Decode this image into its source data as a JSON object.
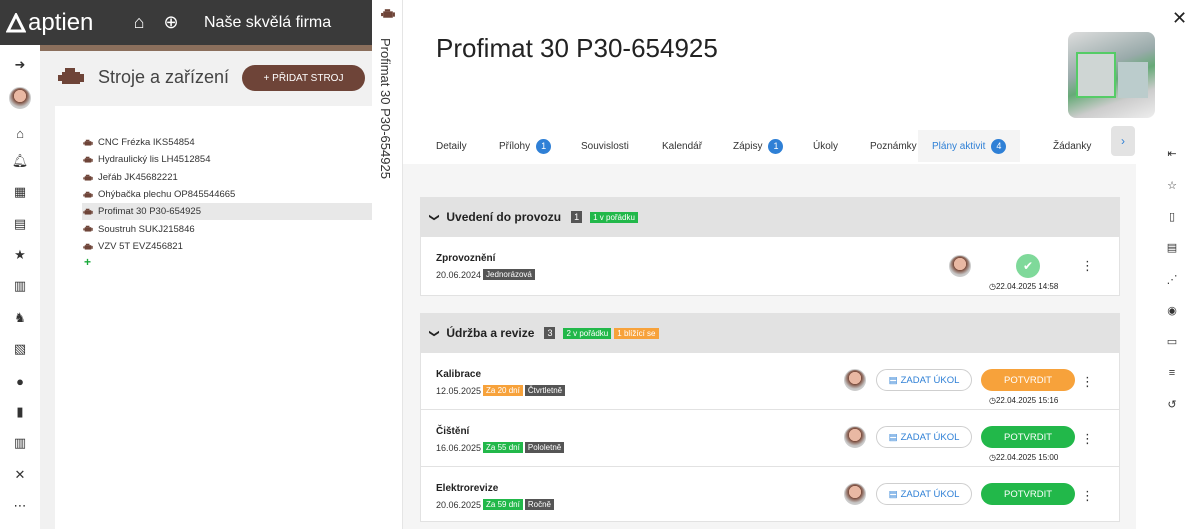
{
  "app": {
    "logo": "aptien",
    "company": "Naše skvělá firma"
  },
  "topbar": {
    "home_icon": "home-icon",
    "add_icon": "plus-circle-icon"
  },
  "leftnav": {
    "icons": [
      "arrow-right-to-bracket-icon",
      "avatar",
      "home-icon",
      "bell-icon",
      "calendar-icon",
      "clipboard-check-icon",
      "star-icon",
      "document-icon",
      "dog-icon",
      "report-icon",
      "user-icon",
      "clipboard-icon",
      "books-icon",
      "tools-icon",
      "grid-dots-icon"
    ]
  },
  "page": {
    "title": "Stroje a zařízení",
    "add_button": "+ PŘIDAT STROJ"
  },
  "tree": {
    "items": [
      {
        "label": "CNC Frézka IKS54854",
        "selected": false
      },
      {
        "label": "Hydraulický lis LH4512854",
        "selected": false
      },
      {
        "label": "Jeřáb JK45682221",
        "selected": false
      },
      {
        "label": "Ohýbačka plechu OP845544665",
        "selected": false
      },
      {
        "label": "Profimat 30 P30-654925",
        "selected": true
      },
      {
        "label": "Soustruh SUKJ215846",
        "selected": false
      },
      {
        "label": "VZV 5T EVZ456821",
        "selected": false
      }
    ],
    "add_symbol": "+"
  },
  "vertical_title": "Profimat 30 P30-654925",
  "detail": {
    "title": "Profimat 30 P30-654925",
    "close": "✕",
    "tabs": [
      {
        "label": "Detaily",
        "badge": null
      },
      {
        "label": "Přílohy",
        "badge": "1"
      },
      {
        "label": "Souvislosti",
        "badge": null
      },
      {
        "label": "Kalendář",
        "badge": null
      },
      {
        "label": "Zápisy",
        "badge": "1"
      },
      {
        "label": "Úkoly",
        "badge": null
      },
      {
        "label": "Poznámky",
        "badge": null
      },
      {
        "label": "Plány aktivit",
        "badge": "4",
        "active": true
      },
      {
        "label": "Žádanky",
        "badge": null
      }
    ],
    "tab_next": "›"
  },
  "groups": [
    {
      "title": "Uvedení do provozu",
      "count": "1",
      "tags": [
        {
          "text": "1 v pořádku",
          "color": "green"
        }
      ],
      "rows": [
        {
          "name": "Zprovoznění",
          "date": "20.06.2024",
          "tags": [
            {
              "text": "Jednorázová",
              "color": "dark"
            }
          ],
          "done": true,
          "stamp": "22.04.2025 14:58"
        }
      ]
    },
    {
      "title": "Údržba a revize",
      "count": "3",
      "tags": [
        {
          "text": "2 v pořádku",
          "color": "green"
        },
        {
          "text": "1 blížící se",
          "color": "orange"
        }
      ],
      "rows": [
        {
          "name": "Kalibrace",
          "date": "12.05.2025",
          "tags": [
            {
              "text": "Za 20 dní",
              "color": "orange"
            },
            {
              "text": "Čtvrtletně",
              "color": "dark"
            }
          ],
          "task": "ZADAT ÚKOL",
          "confirm": "POTVRDIT",
          "confirm_color": "#f7a23b",
          "stamp": "22.04.2025 15:16"
        },
        {
          "name": "Čištění",
          "date": "16.06.2025",
          "tags": [
            {
              "text": "Za 55 dní",
              "color": "green"
            },
            {
              "text": "Pololetně",
              "color": "dark"
            }
          ],
          "task": "ZADAT ÚKOL",
          "confirm": "POTVRDIT",
          "confirm_color": "#22b84a",
          "stamp": "22.04.2025 15:00"
        },
        {
          "name": "Elektrorevize",
          "date": "20.06.2025",
          "tags": [
            {
              "text": "Za 59 dní",
              "color": "green"
            },
            {
              "text": "Ročně",
              "color": "dark"
            }
          ],
          "task": "ZADAT ÚKOL",
          "confirm": "POTVRDIT",
          "confirm_color": "#22b84a",
          "stamp": ""
        }
      ]
    }
  ],
  "rightnav": {
    "icons": [
      "collapse-left-icon",
      "star-outline-icon",
      "document-icon",
      "document-lines-icon",
      "share-icon",
      "eye-icon",
      "id-card-icon",
      "sliders-icon",
      "history-icon"
    ]
  }
}
